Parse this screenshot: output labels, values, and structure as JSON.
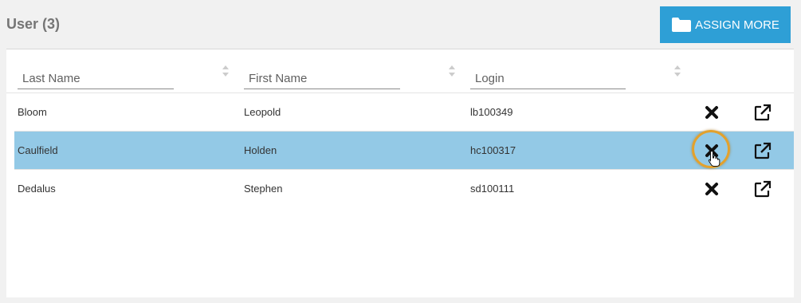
{
  "section": {
    "title": "User (3)"
  },
  "toolbar": {
    "assign_label": "ASSIGN MORE",
    "assign_icon": "folder-icon"
  },
  "columns": [
    {
      "placeholder": "Last Name"
    },
    {
      "placeholder": "First Name"
    },
    {
      "placeholder": "Login"
    }
  ],
  "rows": [
    {
      "last_name": "Bloom",
      "first_name": "Leopold",
      "login": "lb100349",
      "selected": false
    },
    {
      "last_name": "Caulfield",
      "first_name": "Holden",
      "login": "hc100317",
      "selected": true
    },
    {
      "last_name": "Dedalus",
      "first_name": "Stephen",
      "login": "sd100111",
      "selected": false
    }
  ],
  "row_actions": {
    "remove_icon": "close-icon",
    "open_icon": "external-link-icon"
  },
  "colors": {
    "accent": "#2e9fd6",
    "selected_row": "#93c9e6",
    "highlight_ring": "#e3a12c",
    "title": "#757575"
  }
}
